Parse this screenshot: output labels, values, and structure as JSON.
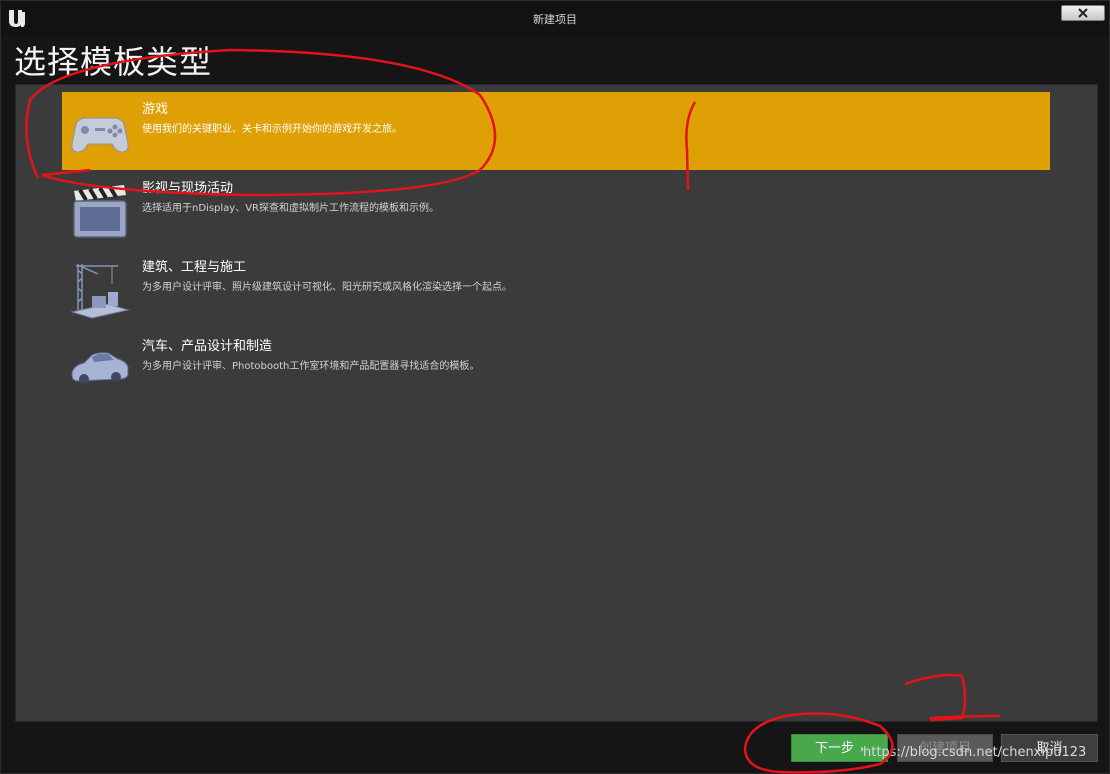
{
  "window": {
    "title": "新建项目",
    "close_label": "close"
  },
  "page_title": "选择模板类型",
  "templates": [
    {
      "name": "游戏",
      "description": "使用我们的关键职业、关卡和示例开始你的游戏开发之旅。",
      "icon": "gamepad-icon",
      "selected": true
    },
    {
      "name": "影视与现场活动",
      "description": "选择适用于nDisplay、VR探查和虚拟制片工作流程的模板和示例。",
      "icon": "clapperboard-icon",
      "selected": false
    },
    {
      "name": "建筑、工程与施工",
      "description": "为多用户设计评审、照片级建筑设计可视化、阳光研究或风格化渲染选择一个起点。",
      "icon": "crane-icon",
      "selected": false
    },
    {
      "name": "汽车、产品设计和制造",
      "description": "为多用户设计评审、Photobooth工作室环境和产品配置器寻找适合的模板。",
      "icon": "car-icon",
      "selected": false
    }
  ],
  "buttons": {
    "next": "下一步",
    "next_arrow": "›",
    "create": "创建项目",
    "cancel": "取消"
  },
  "watermark": "https://blog.csdn.net/chenxipu123",
  "annotations": {
    "mark_1": "1",
    "mark_2": "2"
  },
  "colors": {
    "selected": "#dfa006",
    "next_button": "#4aa84c",
    "annotation": "#e3131a"
  }
}
